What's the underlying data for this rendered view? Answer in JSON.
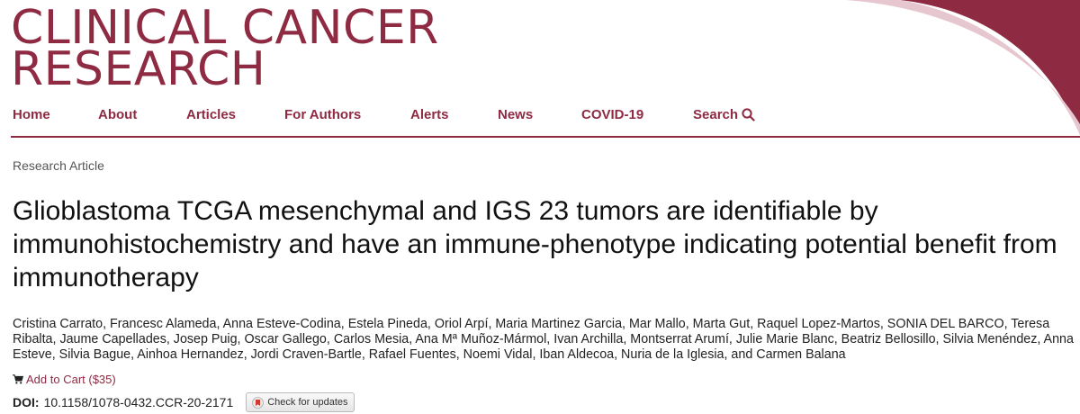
{
  "brand": {
    "line1": "CLINICAL CANCER",
    "line2": "RESEARCH",
    "color": "#8f2a43"
  },
  "nav": {
    "items": [
      {
        "label": "Home"
      },
      {
        "label": "About"
      },
      {
        "label": "Articles"
      },
      {
        "label": "For Authors"
      },
      {
        "label": "Alerts"
      },
      {
        "label": "News"
      },
      {
        "label": "COVID-19"
      },
      {
        "label": "Search",
        "icon": "search-icon"
      }
    ]
  },
  "article": {
    "type": "Research Article",
    "title": "Glioblastoma TCGA mesenchymal and IGS 23 tumors are identifiable by immunohistochemistry and have an immune-phenotype indicating potential benefit from immunotherapy",
    "authors": "Cristina Carrato, Francesc Alameda, Anna Esteve-Codina, Estela Pineda, Oriol Arpí, Maria Martinez Garcia, Mar Mallo, Marta Gut, Raquel Lopez-Martos, SONIA DEL BARCO, Teresa Ribalta, Jaume Capellades, Josep Puig, Oscar Gallego, Carlos Mesia, Ana Mª Muñoz-Mármol, Ivan Archilla, Montserrat Arumí, Julie Marie Blanc, Beatriz Bellosillo, Silvia Menéndez, Anna Esteve, Silvia Bague, Ainhoa Hernandez, Jordi Craven-Bartle, Rafael Fuentes, Noemi Vidal, Iban Aldecoa, Nuria de la Iglesia, and Carmen Balana",
    "cart_label": "Add to Cart ($35)",
    "doi_label": "DOI:",
    "doi_value": "10.1158/1078-0432.CCR-20-2171",
    "check_updates_label": "Check for updates"
  }
}
